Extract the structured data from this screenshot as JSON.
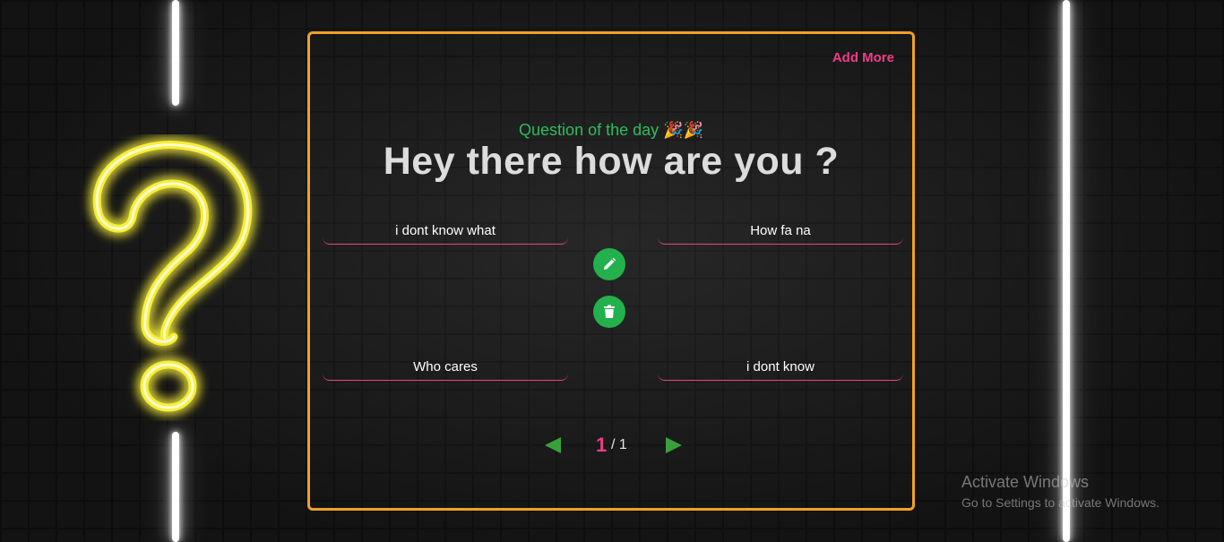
{
  "header": {
    "add_more_label": "Add More"
  },
  "question": {
    "subtitle": "Question of the day 🎉🎉",
    "text": "Hey there how are you ?"
  },
  "options": [
    {
      "label": "i dont know what"
    },
    {
      "label": "How fa na"
    },
    {
      "label": "Who cares"
    },
    {
      "label": "i dont know"
    }
  ],
  "actions": {
    "edit_icon": "pencil-icon",
    "delete_icon": "trash-icon"
  },
  "pagination": {
    "current": "1",
    "total": "/ 1"
  },
  "watermark": {
    "title": "Activate Windows",
    "subtitle": "Go to Settings to activate Windows."
  },
  "colors": {
    "card_border": "#f0a126",
    "accent_pink": "#ee3e87",
    "accent_green": "#22b14c",
    "neon_yellow": "#f7ee3a"
  }
}
